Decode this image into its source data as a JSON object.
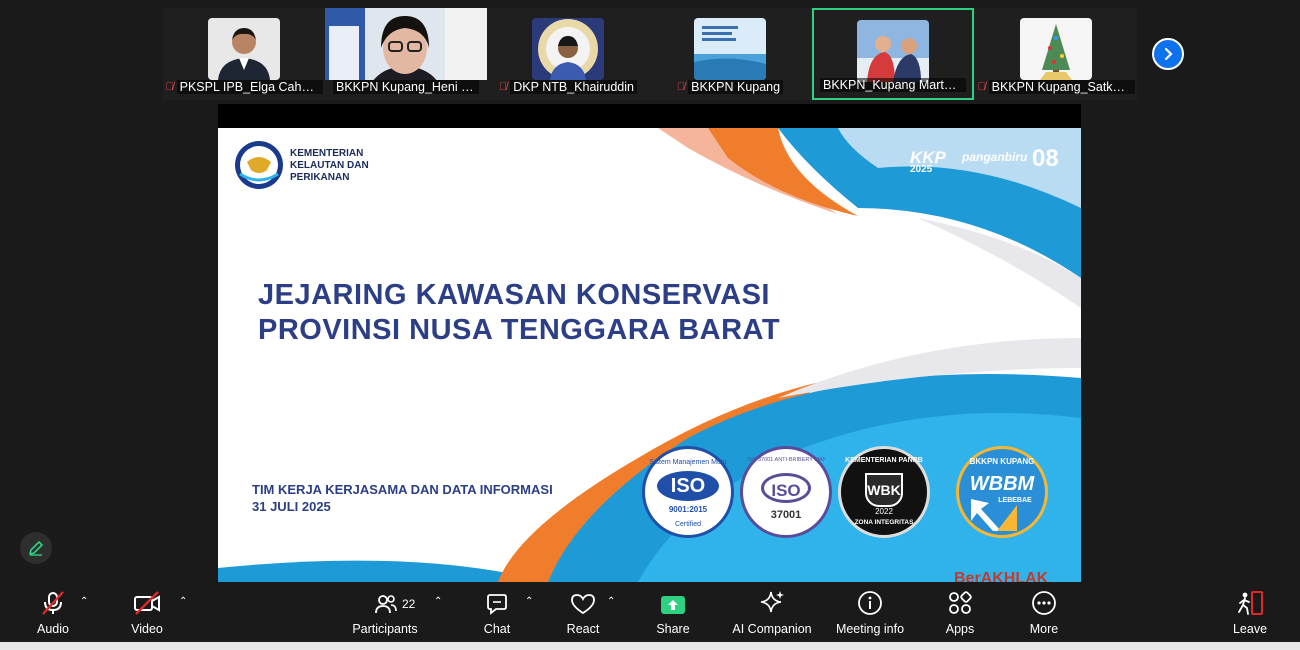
{
  "participants_strip": {
    "tiles": [
      {
        "name": "PKSPL IPB_Elga Cahya ...",
        "muted": true
      },
      {
        "name": "BKKPN Kupang_Heni Radi...",
        "muted": false
      },
      {
        "name": "DKP NTB_Khairuddin",
        "muted": true
      },
      {
        "name": "BKKPN Kupang",
        "muted": true
      },
      {
        "name": "BKKPN_Kupang Martanin...",
        "muted": false,
        "active": true
      },
      {
        "name": "BKKPN Kupang_Satker...",
        "muted": true
      }
    ]
  },
  "slide": {
    "ministry": [
      "KEMENTERIAN",
      "KELAUTAN DAN",
      "PERIKANAN"
    ],
    "brand_kkp": "KKP",
    "brand_year": "2025",
    "brand_tag": "panganbiru",
    "brand_num": "08",
    "title_line1": "JEJARING KAWASAN KONSERVASI",
    "title_line2": "PROVINSI NUSA TENGGARA BARAT",
    "team_line1": "TIM KERJA KERJASAMA DAN DATA INFORMASI",
    "team_line2": "31 JULI 2025",
    "badges": {
      "iso1_top": "Sistem Manajemen Mutu",
      "iso1_main": "ISO",
      "iso1_sub": "9001:2015",
      "iso1_bottom": "Certified",
      "iso2_top": "ISO 37001 ANTI-BRIBERY MANAGEMENT",
      "iso2_main": "ISO",
      "iso2_sub": "37001",
      "wbk_top": "KEMENTERIAN PANRB",
      "wbk_main": "WBK",
      "wbk_year": "2022",
      "wbk_bottom": "ZONA INTEGRITAS",
      "wbbm_top": "BKKPN KUPANG",
      "wbbm_main": "WBBM",
      "wbbm_sub": "LEBEBAE"
    },
    "corner_text": "BerAKHLAK"
  },
  "toolbar": {
    "audio": "Audio",
    "video": "Video",
    "participants": "Participants",
    "participants_count": "22",
    "chat": "Chat",
    "react": "React",
    "share": "Share",
    "ai": "AI Companion",
    "meeting_info": "Meeting info",
    "apps": "Apps",
    "more": "More",
    "leave": "Leave"
  },
  "colors": {
    "accent": "#0e72ed",
    "share_green": "#2fd07f",
    "muted_red": "#e5484d",
    "slide_blue": "#2c3e86",
    "leave_red": "#e02828"
  },
  "icons": [
    "mic-muted-icon",
    "video-off-icon",
    "participants-icon",
    "chat-icon",
    "react-heart-icon",
    "share-arrow-icon",
    "ai-sparkle-icon",
    "info-icon",
    "apps-icon",
    "more-icon",
    "leave-icon",
    "pencil-icon",
    "chevron-right-icon"
  ]
}
